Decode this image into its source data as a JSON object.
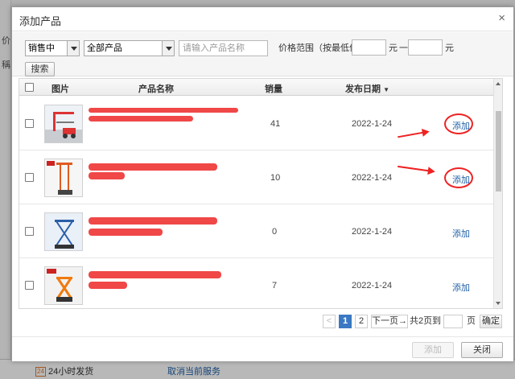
{
  "background": {
    "bottom_bar": {
      "shipping_label": "24小时发货",
      "cancel_service_label": "取消当前服务"
    },
    "left_fragments": [
      "价",
      "稱"
    ]
  },
  "dialog": {
    "title": "添加产品",
    "close_glyph": "×"
  },
  "filters": {
    "status_select": "销售中",
    "category_select": "全部产品",
    "name_placeholder": "请输入产品名称",
    "price_label": "价格范围（按最低价）",
    "price_unit": "元",
    "price_dash": "一",
    "price_min": "",
    "price_max": "",
    "search_button": "搜索"
  },
  "table": {
    "columns": {
      "image": "图片",
      "name": "产品名称",
      "sales": "销量",
      "date": "发布日期"
    },
    "sort_indicator": "▼",
    "add_label": "添加",
    "rows": [
      {
        "name_visible": "...",
        "sales": "41",
        "date": "2022-1-24"
      },
      {
        "name_visible": "",
        "sales": "10",
        "date": "2022-1-24"
      },
      {
        "name_visible": "",
        "sales": "0",
        "date": "2022-1-24"
      },
      {
        "name_visible": "",
        "sales": "7",
        "date": "2022-1-24"
      }
    ]
  },
  "pagination": {
    "prev": "<",
    "pages": [
      "1",
      "2"
    ],
    "current": "1",
    "next": "下一页",
    "next_arrow": "→",
    "total_text": "共2页",
    "goto_label": "到",
    "page_unit": "页",
    "confirm": "确定"
  },
  "footer": {
    "add_button": "添加",
    "close_button": "关闭"
  },
  "colors": {
    "accent": "#3a78c3",
    "link": "#1f5fa6",
    "annotation_red": "#e22222"
  }
}
